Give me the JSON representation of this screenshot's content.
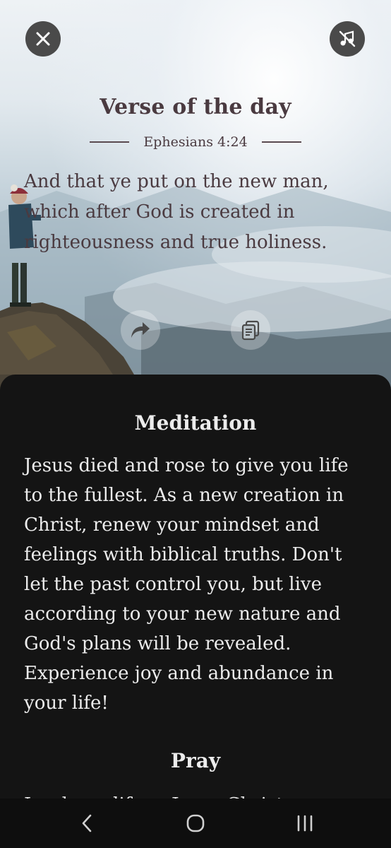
{
  "header": {
    "close_icon": "close-icon",
    "music_icon": "music-off-icon"
  },
  "verse": {
    "title": "Verse of the day",
    "reference": "Ephesians 4:24",
    "text": "And that ye put on the new man, which after God is created in righteousness and true holiness."
  },
  "actions": {
    "share_icon": "share-icon",
    "copy_icon": "copy-icon"
  },
  "meditation": {
    "title": "Meditation",
    "text": "Jesus died and rose to give you life to the fullest. As a new creation in Christ, renew your mindset and feelings with biblical truths. Don't let the past control you, but live according to your new nature and God's plans will be revealed. Experience joy and abundance in your life!"
  },
  "pray": {
    "title": "Pray",
    "peek_text": "Lord, my life ... Jesus Christ..."
  },
  "navbar": {
    "back_icon": "back-icon",
    "home_icon": "home-icon",
    "recents_icon": "recents-icon"
  },
  "colors": {
    "sheet_bg": "#141414",
    "hero_text": "#4a3a40",
    "sheet_text": "#ececec"
  }
}
